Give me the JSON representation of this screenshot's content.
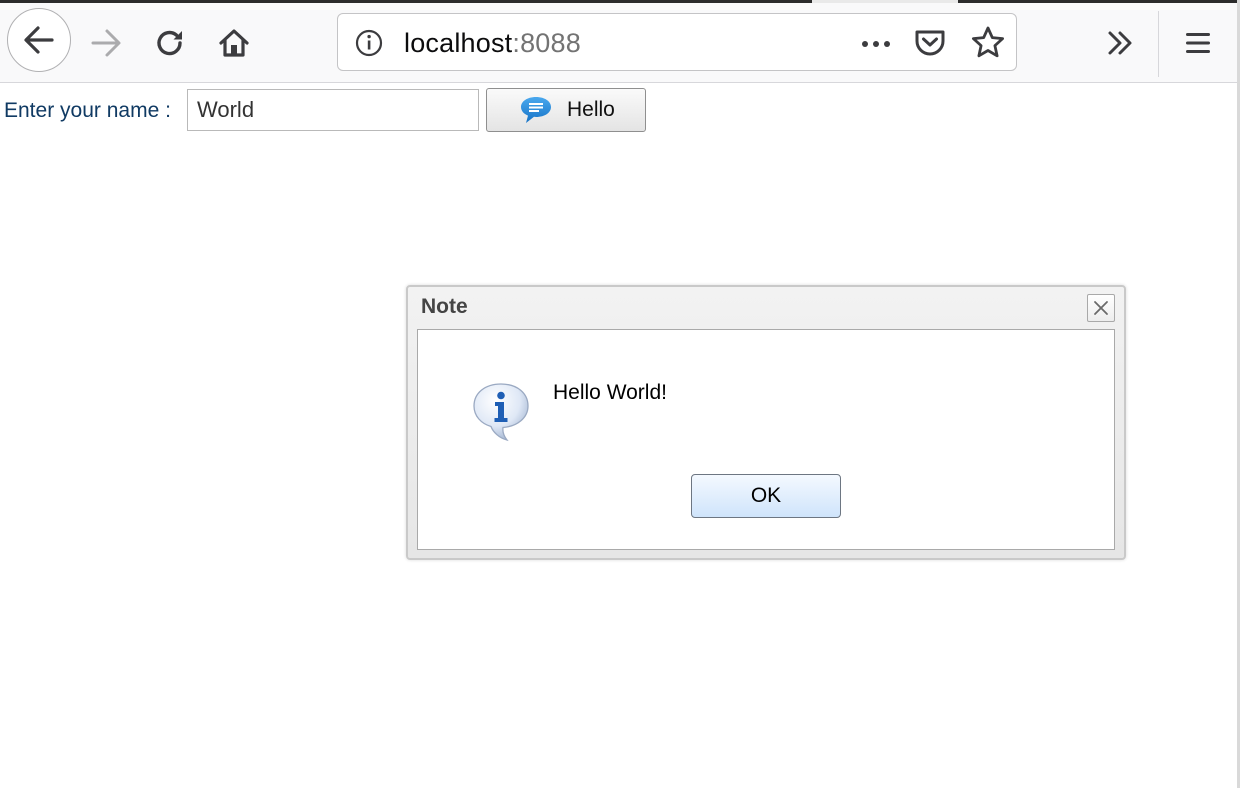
{
  "browser": {
    "url_host": "localhost",
    "url_port": ":8088",
    "icons": {
      "back": "back-arrow-icon",
      "forward": "forward-arrow-icon",
      "reload": "reload-icon",
      "home": "home-icon",
      "site_info": "info-icon",
      "page_actions": "more-horizontal-icon",
      "pocket": "pocket-icon",
      "bookmark": "star-icon",
      "overflow": "double-chevron-icon",
      "menu": "hamburger-menu-icon"
    }
  },
  "form": {
    "name_label": "Enter your name :",
    "name_value": "World",
    "hello_button_label": "Hello",
    "hello_button_icon": "speech-bubble-icon"
  },
  "dialog": {
    "title": "Note",
    "message": "Hello World!",
    "ok_label": "OK",
    "icon": "info-speech-bubble-icon",
    "close_icon": "close-icon"
  },
  "colors": {
    "label_text": "#103a63",
    "accent_blue": "#1f86d8",
    "ok_button_top": "#f4f9ff",
    "ok_button_bottom": "#cfe4fb"
  }
}
